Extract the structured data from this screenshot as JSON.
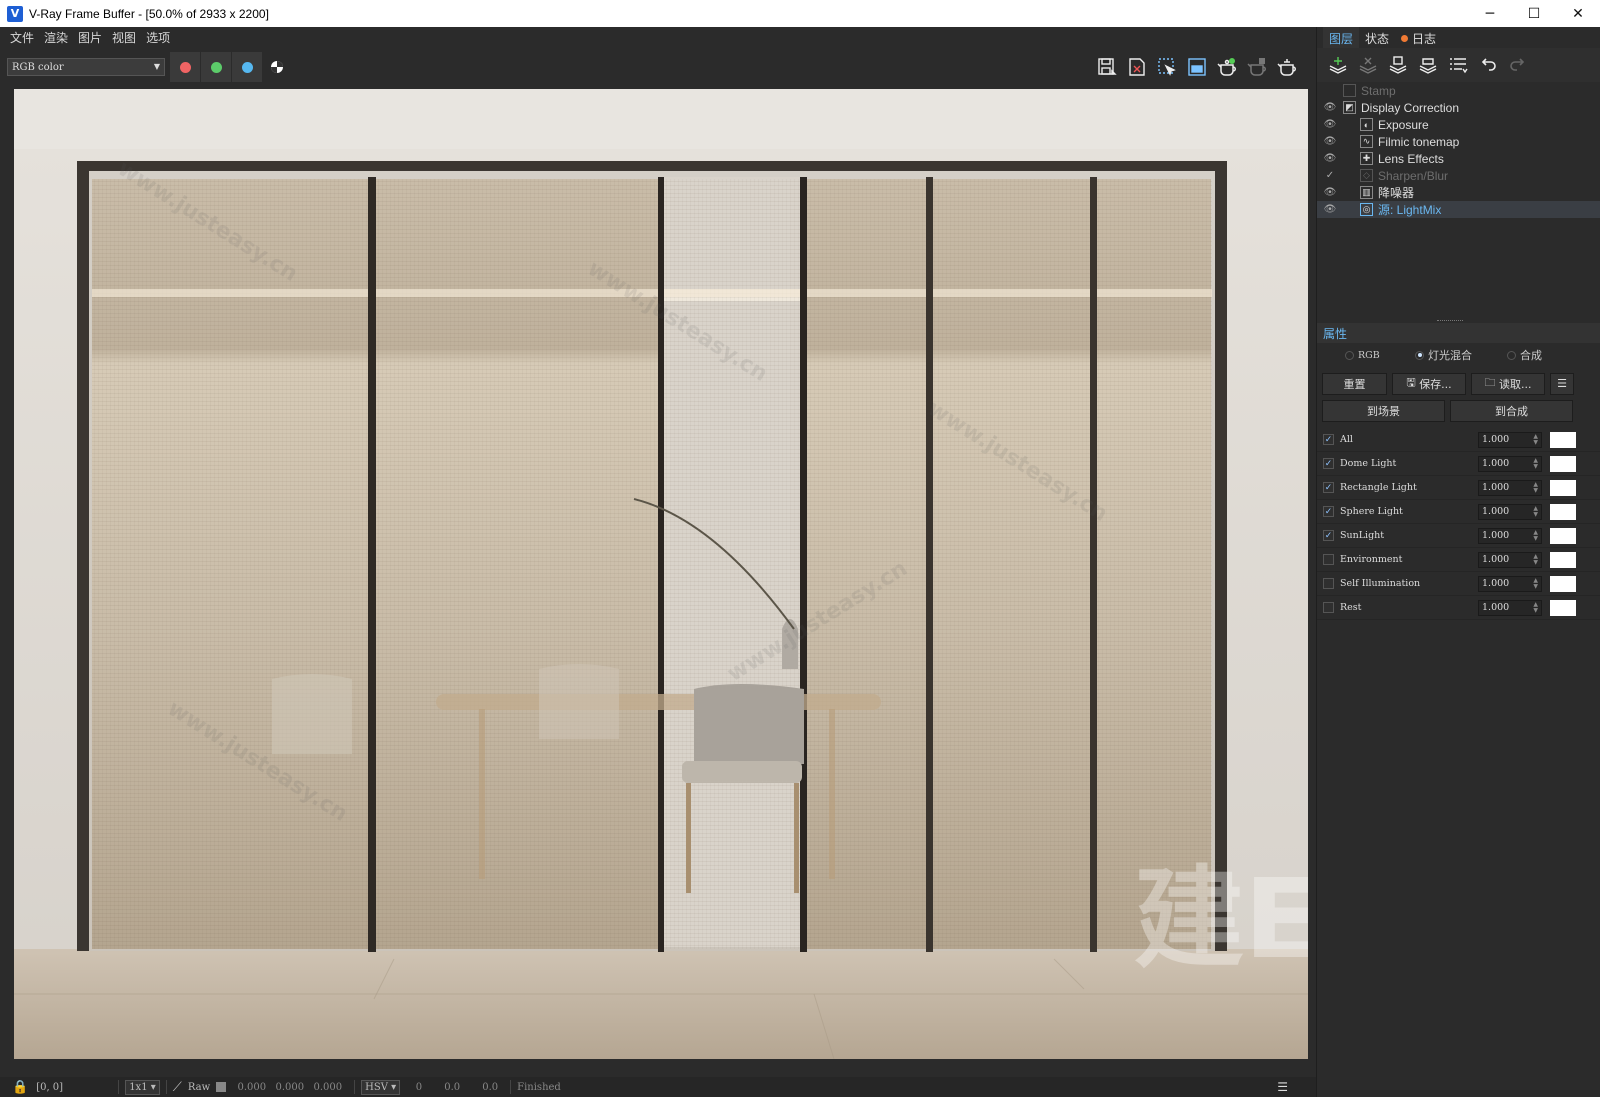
{
  "window": {
    "title": "V-Ray Frame Buffer - [50.0% of 2933 x 2200]",
    "minimize": "─",
    "maximize": "☐",
    "close": "✕"
  },
  "menu": [
    "文件",
    "渲染",
    "图片",
    "视图",
    "选项"
  ],
  "toolbar": {
    "channel": "RGB color",
    "channel_colors": [
      "#f06464",
      "#5ccc6a",
      "#56b8f0"
    ],
    "right_icons": [
      "save-image-icon",
      "clear-image-icon",
      "region-render-icon",
      "track-mouse-icon",
      "render-teapot-icon",
      "stop-render-icon",
      "interactive-teapot-icon"
    ]
  },
  "right_panel": {
    "tabs": [
      "图层",
      "状态",
      "日志"
    ],
    "layers": [
      {
        "name": "Stamp",
        "icon": "stamp-icon",
        "visible": false,
        "indent": 0
      },
      {
        "name": "Display Correction",
        "icon": "display-correction-icon",
        "visible": true,
        "indent": 0
      },
      {
        "name": "Exposure",
        "icon": "exposure-icon",
        "visible": true,
        "indent": 1
      },
      {
        "name": "Filmic tonemap",
        "icon": "filmic-icon",
        "visible": true,
        "indent": 1
      },
      {
        "name": "Lens Effects",
        "icon": "lens-effects-icon",
        "visible": true,
        "indent": 1
      },
      {
        "name": "Sharpen/Blur",
        "icon": "sharpen-icon",
        "visible": false,
        "indent": 1
      },
      {
        "name": "降噪器",
        "icon": "denoiser-icon",
        "visible": true,
        "indent": 1
      },
      {
        "name": "源: LightMix",
        "icon": "source-icon",
        "visible": true,
        "indent": 1,
        "selected": true
      }
    ],
    "properties_title": "属性",
    "modes": [
      "RGB",
      "灯光混合",
      "合成"
    ],
    "selected_mode": "灯光混合",
    "buttons": {
      "reset": "重置",
      "save": "保存...",
      "load": "读取...",
      "to_scene": "到场景",
      "to_composite": "到合成"
    },
    "lights": [
      {
        "name": "All",
        "value": "1.000",
        "checked": true
      },
      {
        "name": "Dome Light",
        "value": "1.000",
        "checked": true
      },
      {
        "name": "Rectangle Light",
        "value": "1.000",
        "checked": true
      },
      {
        "name": "Sphere Light",
        "value": "1.000",
        "checked": true
      },
      {
        "name": "SunLight",
        "value": "1.000",
        "checked": true
      },
      {
        "name": "Environment",
        "value": "1.000",
        "checked": false
      },
      {
        "name": "Self Illumination",
        "value": "1.000",
        "checked": false
      },
      {
        "name": "Rest",
        "value": "1.000",
        "checked": false
      }
    ]
  },
  "status": {
    "coords": "[0, 0]",
    "zoom": "1x1",
    "raw": "Raw",
    "values": [
      "0.000",
      "0.000",
      "0.000"
    ],
    "color_mode": "HSV",
    "hsv": [
      "0",
      "0.0",
      "0.0"
    ],
    "state": "Finished"
  },
  "watermark": {
    "big": "建E网",
    "small": "www.justeasy.cn"
  }
}
